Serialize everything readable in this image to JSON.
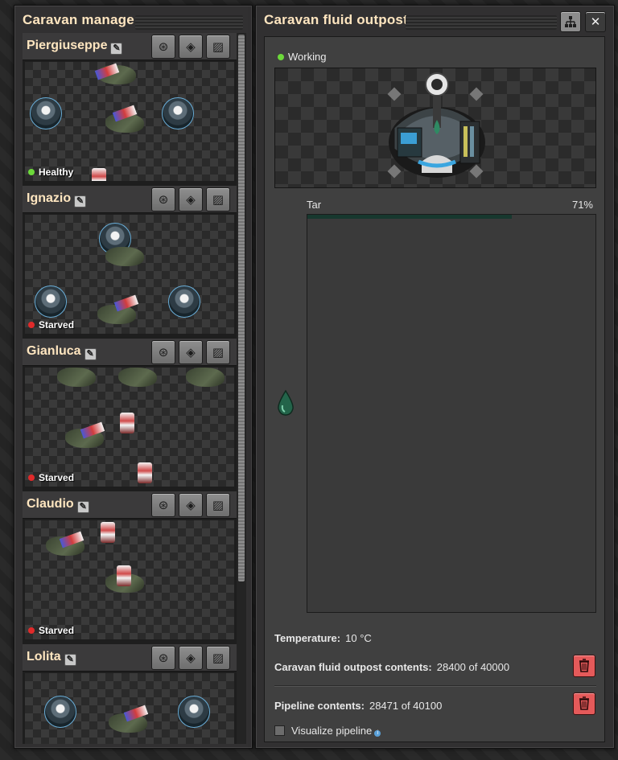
{
  "caravan_manager": {
    "title": "Caravan manager",
    "caravans": [
      {
        "name": "Piergiuseppe",
        "status": "Healthy",
        "status_color": "#6cd93a"
      },
      {
        "name": "Ignazio",
        "status": "Starved",
        "status_color": "#e02a2a"
      },
      {
        "name": "Gianluca",
        "status": "Starved",
        "status_color": "#e02a2a"
      },
      {
        "name": "Claudio",
        "status": "Starved",
        "status_color": "#e02a2a"
      },
      {
        "name": "Lolita",
        "status": "",
        "status_color": "#e02a2a"
      }
    ],
    "tool_icons": [
      "follow-icon",
      "remote-view-icon",
      "map-icon"
    ]
  },
  "outpost": {
    "title": "Caravan fluid outpost",
    "status": "Working",
    "status_color": "#6cd93a",
    "fluid": {
      "name": "Tar",
      "percent_label": "71%",
      "fill_fraction": 0.71,
      "color": "#17382e"
    },
    "temperature": {
      "label": "Temperature:",
      "value": "10 °C"
    },
    "outpost_contents": {
      "label": "Caravan fluid outpost contents:",
      "value": "28400 of 40000"
    },
    "pipeline_contents": {
      "label": "Pipeline contents:",
      "value": "28471 of 40100"
    },
    "visualize_label": "Visualize pipeline"
  }
}
